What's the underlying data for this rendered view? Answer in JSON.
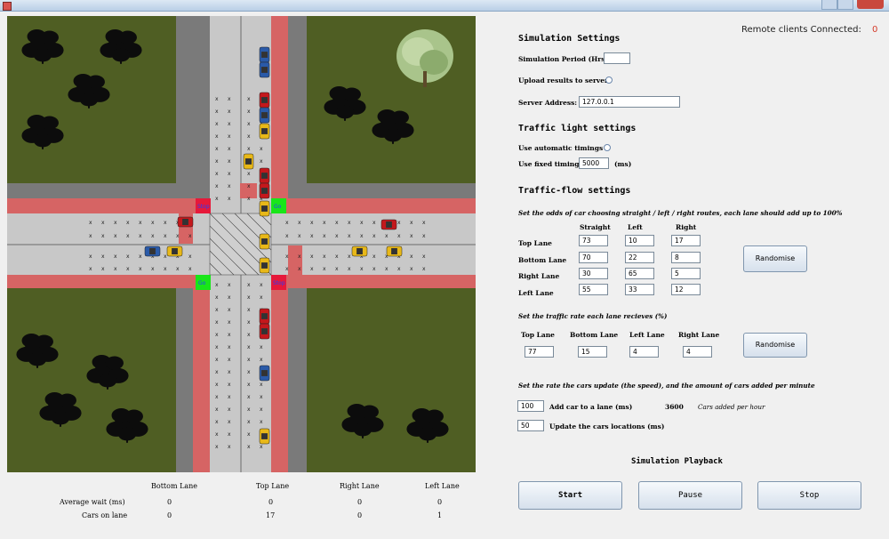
{
  "header": {
    "remote_label": "Remote clients Connected:",
    "remote_value": "0"
  },
  "simulation": {
    "signals": {
      "top_left": "Stop",
      "top_right": "Go",
      "bottom_left": "Go",
      "bottom_right": "Stop"
    },
    "colors": {
      "grass": "#4f5e23",
      "sidewalk": "#7a7a7a",
      "road": "#c8c8c8",
      "lane_red": "#d66464",
      "go_green": "#19e619",
      "stop_red": "#e6193a"
    }
  },
  "stats": {
    "columns": [
      "Bottom Lane",
      "Top Lane",
      "Right Lane",
      "Left Lane"
    ],
    "rows": [
      {
        "label": "Average wait (ms)",
        "values": [
          "0",
          "0",
          "0",
          "0"
        ]
      },
      {
        "label": "Cars on lane",
        "values": [
          "0",
          "17",
          "0",
          "1"
        ]
      }
    ]
  },
  "settings": {
    "sim_heading": "Simulation Settings",
    "period_label": "Simulation Period (Hrs):",
    "period_value": "",
    "upload_label": "Upload results to server",
    "server_label": "Server Address:",
    "server_value": "127.0.0.1",
    "light_heading": "Traffic light settings",
    "auto_label": "Use automatic timings",
    "fixed_label": "Use fixed timings",
    "fixed_value": "5000",
    "fixed_unit": "(ms)",
    "flow_heading": "Traffic-flow settings",
    "odds_note": "Set the odds of car choosing straight / left / right routes, each lane should add up to 100%",
    "odds_columns": [
      "Straight",
      "Left",
      "Right"
    ],
    "odds_rows": [
      {
        "label": "Top Lane",
        "values": [
          "73",
          "10",
          "17"
        ]
      },
      {
        "label": "Bottom Lane",
        "values": [
          "70",
          "22",
          "8"
        ]
      },
      {
        "label": "Right Lane",
        "values": [
          "30",
          "65",
          "5"
        ]
      },
      {
        "label": "Left Lane",
        "values": [
          "55",
          "33",
          "12"
        ]
      }
    ],
    "randomise_label": "Randomise",
    "rate_note": "Set the traffic rate each lane recieves (%)",
    "rate_columns": [
      "Top Lane",
      "Bottom Lane",
      "Left Lane",
      "Right Lane"
    ],
    "rate_values": [
      "77",
      "15",
      "4",
      "4"
    ],
    "speed_note": "Set the rate the cars update (the speed), and the amount of cars added per minute",
    "add_value": "100",
    "add_label": "Add car to a lane (ms)",
    "per_hour_value": "3600",
    "per_hour_label": "Cars added per hour",
    "update_value": "50",
    "update_label": "Update the cars locations (ms)"
  },
  "playback": {
    "heading": "Simulation Playback",
    "start": "Start",
    "pause": "Pause",
    "stop": "Stop"
  }
}
